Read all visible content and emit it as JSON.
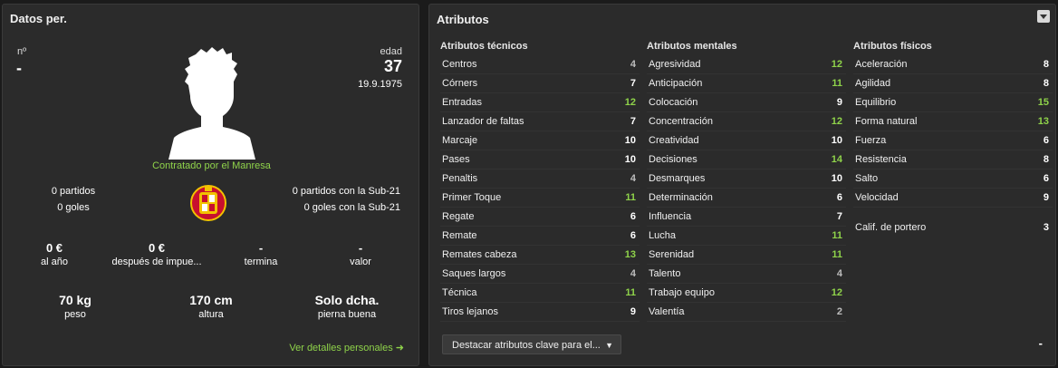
{
  "personal": {
    "title": "Datos per.",
    "number_label": "nº",
    "number_value": "-",
    "age_label": "edad",
    "age_value": "37",
    "dob": "19.9.1975",
    "contract_text": "Contratado por el Manresa",
    "left_stats": [
      "0 partidos",
      "0 goles"
    ],
    "right_stats": [
      "0 partidos con la Sub-21",
      "0 goles con la Sub-21"
    ],
    "finance": [
      {
        "value": "0 €",
        "label": "al año"
      },
      {
        "value": "0 €",
        "label": "después de impue..."
      },
      {
        "value": "-",
        "label": "termina"
      },
      {
        "value": "-",
        "label": "valor"
      }
    ],
    "physical": [
      {
        "value": "70 kg",
        "label": "peso"
      },
      {
        "value": "170 cm",
        "label": "altura"
      },
      {
        "value": "Solo dcha.",
        "label": "pierna buena"
      }
    ],
    "details_link": "Ver detalles personales ➜"
  },
  "attributes": {
    "title": "Atributos",
    "dropdown_label": "Destacar atributos clave para el...",
    "footer_dash": "-",
    "colors": {
      "white": "#ffffff",
      "green": "#8fd34a",
      "grey": "#bdbdbd"
    },
    "technical": {
      "title": "Atributos técnicos",
      "rows": [
        {
          "name": "Centros",
          "value": "4"
        },
        {
          "name": "Córners",
          "value": "7"
        },
        {
          "name": "Entradas",
          "value": "12"
        },
        {
          "name": "Lanzador de faltas",
          "value": "7"
        },
        {
          "name": "Marcaje",
          "value": "10"
        },
        {
          "name": "Pases",
          "value": "10"
        },
        {
          "name": "Penaltis",
          "value": "4"
        },
        {
          "name": "Primer Toque",
          "value": "11"
        },
        {
          "name": "Regate",
          "value": "6"
        },
        {
          "name": "Remate",
          "value": "6"
        },
        {
          "name": "Remates cabeza",
          "value": "13"
        },
        {
          "name": "Saques largos",
          "value": "4"
        },
        {
          "name": "Técnica",
          "value": "11"
        },
        {
          "name": "Tiros lejanos",
          "value": "9"
        }
      ]
    },
    "mental": {
      "title": "Atributos mentales",
      "rows": [
        {
          "name": "Agresividad",
          "value": "12"
        },
        {
          "name": "Anticipación",
          "value": "11"
        },
        {
          "name": "Colocación",
          "value": "9"
        },
        {
          "name": "Concentración",
          "value": "12"
        },
        {
          "name": "Creatividad",
          "value": "10"
        },
        {
          "name": "Decisiones",
          "value": "14"
        },
        {
          "name": "Desmarques",
          "value": "10"
        },
        {
          "name": "Determinación",
          "value": "6"
        },
        {
          "name": "Influencia",
          "value": "7"
        },
        {
          "name": "Lucha",
          "value": "11"
        },
        {
          "name": "Serenidad",
          "value": "11"
        },
        {
          "name": "Talento",
          "value": "4"
        },
        {
          "name": "Trabajo equipo",
          "value": "12"
        },
        {
          "name": "Valentía",
          "value": "2"
        }
      ]
    },
    "physical": {
      "title": "Atributos físicos",
      "rows": [
        {
          "name": "Aceleración",
          "value": "8"
        },
        {
          "name": "Agilidad",
          "value": "8"
        },
        {
          "name": "Equilibrio",
          "value": "15"
        },
        {
          "name": "Forma natural",
          "value": "13"
        },
        {
          "name": "Fuerza",
          "value": "6"
        },
        {
          "name": "Resistencia",
          "value": "8"
        },
        {
          "name": "Salto",
          "value": "6"
        },
        {
          "name": "Velocidad",
          "value": "9"
        }
      ],
      "gk_label": "Calif. de portero",
      "gk_value": "3"
    }
  }
}
